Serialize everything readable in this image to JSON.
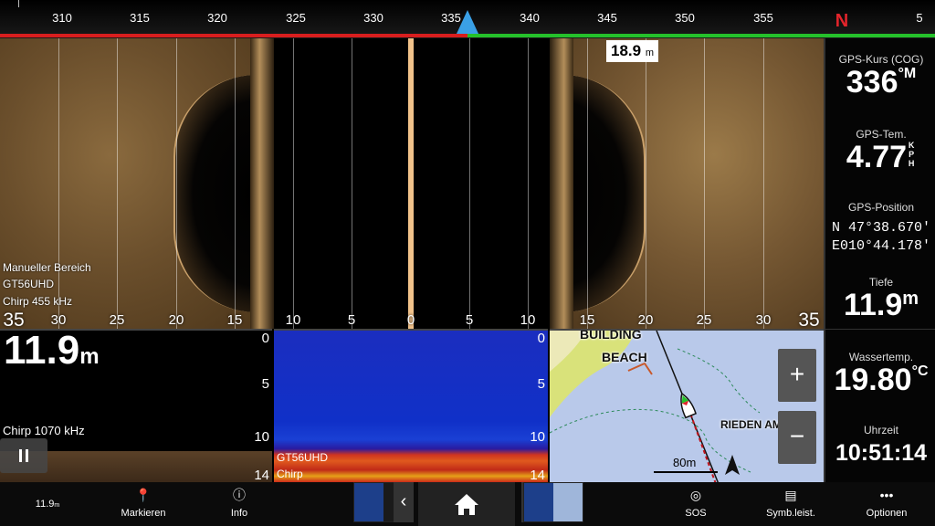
{
  "compass": {
    "ticks": [
      "310",
      "315",
      "320",
      "325",
      "330",
      "335",
      "340",
      "345",
      "350",
      "355",
      "5"
    ],
    "north_label": "N"
  },
  "sidescan": {
    "mode_label": "Manueller Bereich",
    "transducer": "GT56UHD",
    "frequency": "Chirp 455 kHz",
    "range_labels_left": [
      "35",
      "30",
      "25",
      "20",
      "15",
      "10",
      "5",
      "0"
    ],
    "range_labels_right": [
      "5",
      "10",
      "15",
      "20",
      "25",
      "30",
      "35"
    ],
    "depth_marker": "18.9",
    "depth_marker_unit": "m"
  },
  "sidebar": {
    "cog_label": "GPS-Kurs (COG)",
    "cog_value": "336",
    "cog_unit": "°M",
    "sog_label": "GPS-Tem.",
    "sog_value": "4.77",
    "sog_unit": "KPH",
    "pos_label": "GPS-Position",
    "pos_lat": "N  47°38.670'",
    "pos_lon": "E010°44.178'",
    "depth_label": "Tiefe",
    "depth_value": "11.9",
    "depth_unit": "m",
    "temp_label": "Wassertemp.",
    "temp_value": "19.80",
    "temp_unit": "°C",
    "time_label": "Uhrzeit",
    "time_value": "10:51:14"
  },
  "depth_pane": {
    "depth_value": "11.9",
    "depth_unit": "m",
    "scale": [
      "0",
      "5",
      "10",
      "14"
    ],
    "frequency": "Chirp 1070 kHz"
  },
  "sonar_pane": {
    "scale": [
      "0",
      "5",
      "10",
      "14"
    ],
    "transducer": "GT56UHD",
    "mode": "Chirp"
  },
  "map_pane": {
    "label_building": "BUILDING",
    "label_beach": "BEACH",
    "label_rieden": "RIEDEN AM FOR",
    "zoom_in": "+",
    "zoom_out": "−",
    "scale_label": "80m"
  },
  "toolbar": {
    "depth_readout": "11.9",
    "depth_readout_unit": "m",
    "mark_label": "Markieren",
    "info_label": "Info",
    "sos_label": "SOS",
    "symbol_label": "Symb.leist.",
    "options_label": "Optionen"
  },
  "colors": {
    "compass_port": "#d81e1e",
    "compass_starboard": "#25c12b",
    "heading_pointer": "#3aa0e6",
    "north": "#e3242b"
  }
}
